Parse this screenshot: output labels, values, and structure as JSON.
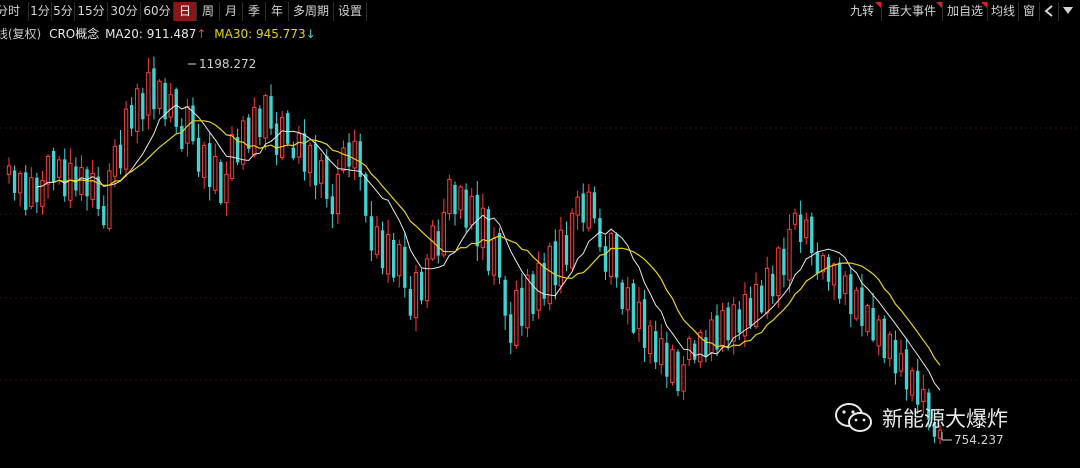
{
  "toolbar": {
    "periods": [
      "分时",
      "1分",
      "5分",
      "15分",
      "30分",
      "60分",
      "日",
      "周",
      "月",
      "季",
      "年",
      "多周期",
      "设置"
    ],
    "active_period": "日",
    "right_buttons": [
      "九转",
      "重大事件",
      "加自选",
      "均线",
      "窗"
    ],
    "back_icon": "back-arrow-icon",
    "menu_icon": "dropdown-menu-icon"
  },
  "info": {
    "prefix": "K线(复权)",
    "name": "CRO概念",
    "ma20_label": "MA20: 911.487",
    "ma20_arrow": "↑",
    "ma30_label": "MA30: 945.773",
    "ma30_arrow": "↓",
    "colors": {
      "ma20": "#e8e8e8",
      "ma30": "#e6d21e",
      "up": "#ff3b3b",
      "down": "#3fd3d3"
    }
  },
  "watermark": {
    "icon": "wechat-icon",
    "text": "新能源大爆炸"
  },
  "chart_data": {
    "type": "candlestick",
    "annotations": {
      "high": "1198.272",
      "low": "754.237"
    },
    "price_range": [
      740,
      1210
    ],
    "closes": [
      1078,
      1046,
      1069,
      1026,
      1064,
      1035,
      1061,
      1089,
      1058,
      1085,
      1042,
      1081,
      1049,
      1076,
      1042,
      1069,
      1027,
      1008,
      1072,
      1101,
      1075,
      1145,
      1122,
      1169,
      1133,
      1188,
      1145,
      1178,
      1133,
      1162,
      1124,
      1098,
      1148,
      1107,
      1071,
      1102,
      1053,
      1089,
      1034,
      1068,
      1115,
      1082,
      1131,
      1098,
      1147,
      1112,
      1161,
      1122,
      1091,
      1135,
      1104,
      1087,
      1116,
      1071,
      1102,
      1055,
      1084,
      1039,
      1021,
      1068,
      1099,
      1077,
      1107,
      1065,
      1019,
      978,
      1006,
      957,
      997,
      946,
      985,
      934,
      901,
      952,
      919,
      968,
      1007,
      972,
      1023,
      1062,
      1021,
      1053,
      1005,
      1042,
      983,
      1028,
      954,
      992,
      946,
      901,
      869,
      931,
      889,
      949,
      903,
      963,
      921,
      983,
      937,
      1002,
      961,
      1022,
      1041,
      1011,
      1047,
      1016,
      982,
      953,
      998,
      946,
      909,
      934,
      881,
      917,
      863,
      889,
      846,
      874,
      829,
      861,
      812,
      843,
      874,
      849,
      881,
      853,
      896,
      861,
      907,
      872,
      914,
      881,
      926,
      889,
      938,
      905,
      957,
      924,
      981,
      949,
      1003,
      1022,
      988,
      1014,
      975,
      951,
      972,
      941,
      962,
      921,
      948,
      903,
      931,
      889,
      913,
      872,
      896,
      851,
      879,
      833,
      856,
      814,
      836,
      796,
      814,
      778,
      758,
      766
    ],
    "ma20_end": 911.487,
    "ma30_end": 945.773
  }
}
